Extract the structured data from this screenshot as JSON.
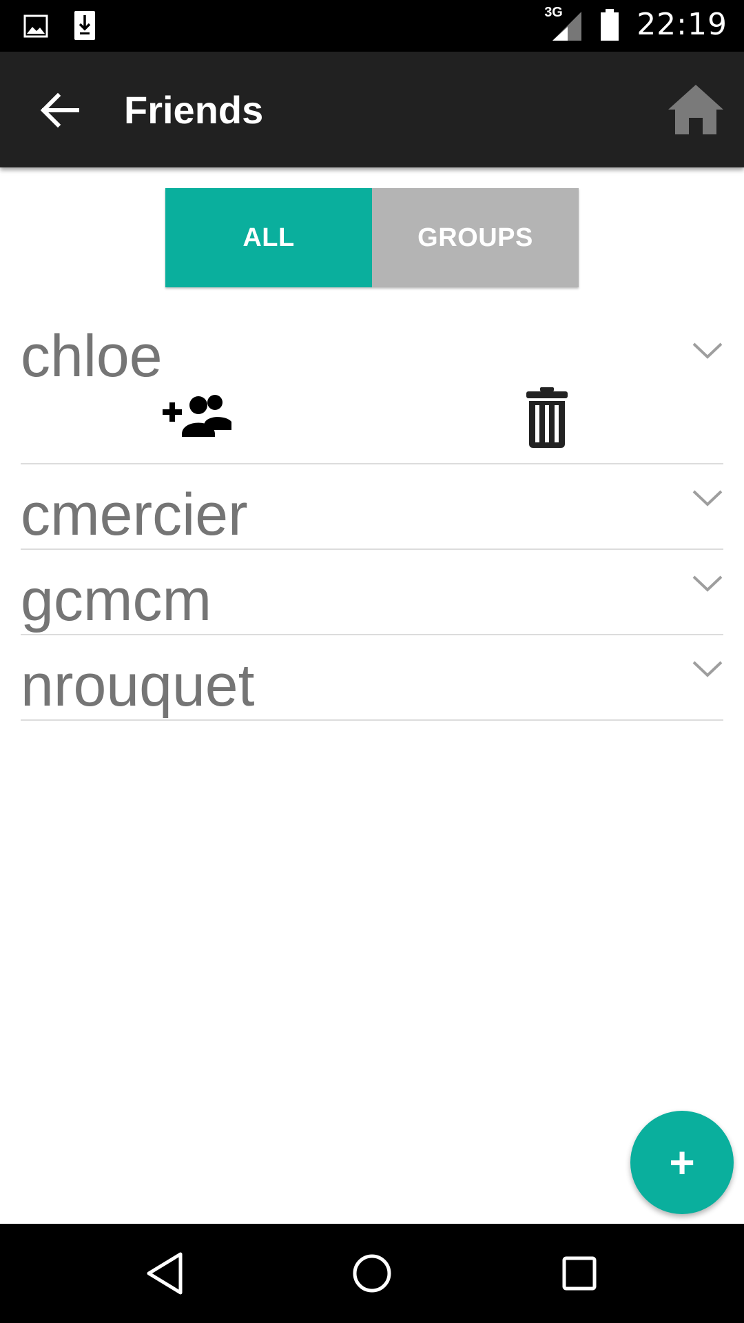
{
  "status_bar": {
    "time": "22:19",
    "network_label": "3G",
    "icons": [
      "image-notification-icon",
      "download-notification-icon",
      "signal-icon",
      "battery-icon"
    ]
  },
  "app_bar": {
    "title": "Friends",
    "back_icon": "arrow-back-icon",
    "home_icon": "home-icon"
  },
  "tabs": [
    {
      "label": "ALL",
      "active": true
    },
    {
      "label": "GROUPS",
      "active": false
    }
  ],
  "friends": [
    {
      "name": "chloe",
      "expanded": true
    },
    {
      "name": "cmercier",
      "expanded": false
    },
    {
      "name": "gcmcm",
      "expanded": false
    },
    {
      "name": "nrouquet",
      "expanded": false
    }
  ],
  "expanded_actions": {
    "add_to_group_icon": "group-add-icon",
    "delete_icon": "trash-icon"
  },
  "fab": {
    "label": "+"
  },
  "nav_bar": {
    "icons": [
      "back-triangle-icon",
      "home-circle-icon",
      "recents-square-icon"
    ]
  },
  "colors": {
    "accent": "#0aaf9d",
    "app_bar": "#212121",
    "tab_inactive": "#b4b4b4",
    "name_text": "#757575"
  }
}
